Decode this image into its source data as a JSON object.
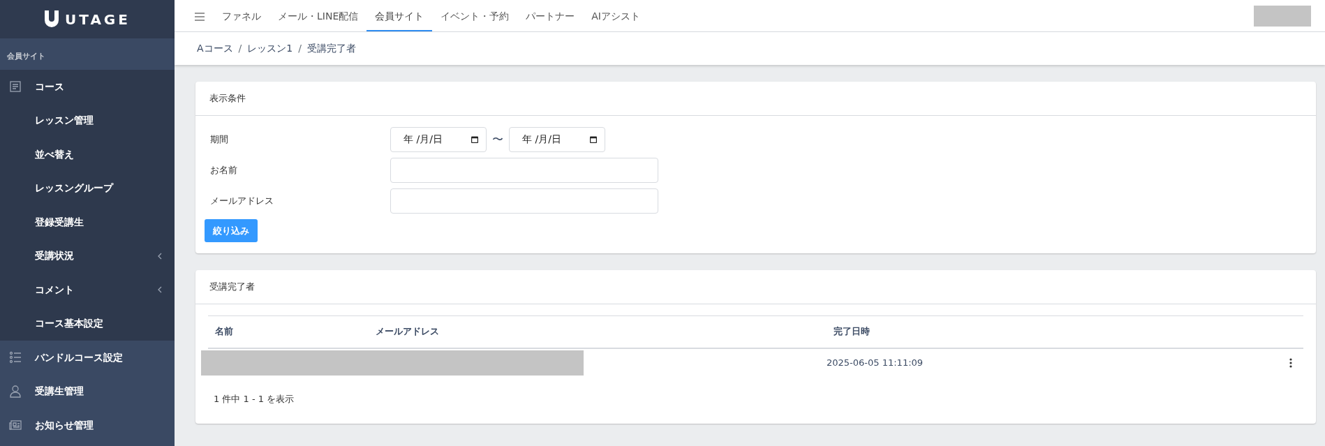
{
  "brand": {
    "name": "UTAGE"
  },
  "sidebar": {
    "section": "会員サイト",
    "items": [
      {
        "label": "コース",
        "expanded": true,
        "children": [
          {
            "label": "レッスン管理",
            "expandable": false
          },
          {
            "label": "並べ替え",
            "expandable": false
          },
          {
            "label": "レッスングループ",
            "expandable": false
          },
          {
            "label": "登録受講生",
            "expandable": false
          },
          {
            "label": "受講状況",
            "expandable": true
          },
          {
            "label": "コメント",
            "expandable": true
          },
          {
            "label": "コース基本設定",
            "expandable": false
          }
        ]
      },
      {
        "label": "バンドルコース設定",
        "expanded": false
      },
      {
        "label": "受講生管理",
        "expanded": false
      },
      {
        "label": "お知らせ管理",
        "expanded": false
      }
    ]
  },
  "tabs": [
    {
      "label": "ファネル",
      "selected": false
    },
    {
      "label": "メール・LINE配信",
      "selected": false
    },
    {
      "label": "会員サイト",
      "selected": true
    },
    {
      "label": "イベント・予約",
      "selected": false
    },
    {
      "label": "パートナー",
      "selected": false
    },
    {
      "label": "AIアシスト",
      "selected": false
    }
  ],
  "breadcrumb": {
    "separator": "/",
    "items": [
      "Aコース",
      "レッスン1",
      "受講完了者"
    ]
  },
  "filter": {
    "title": "表示条件",
    "period_label": "期間",
    "date_from": "年 /月/日",
    "separator": "〜",
    "date_to": "年 /月/日",
    "name_label": "お名前",
    "email_label": "メールアドレス",
    "button": "絞り込み"
  },
  "results": {
    "title": "受講完了者",
    "columns": [
      "名前",
      "メールアドレス",
      "完了日時"
    ],
    "rows": [
      {
        "completed_at": "2025-06-05 11:11:09"
      }
    ],
    "summary": "1 件中 1 - 1 を表示"
  }
}
